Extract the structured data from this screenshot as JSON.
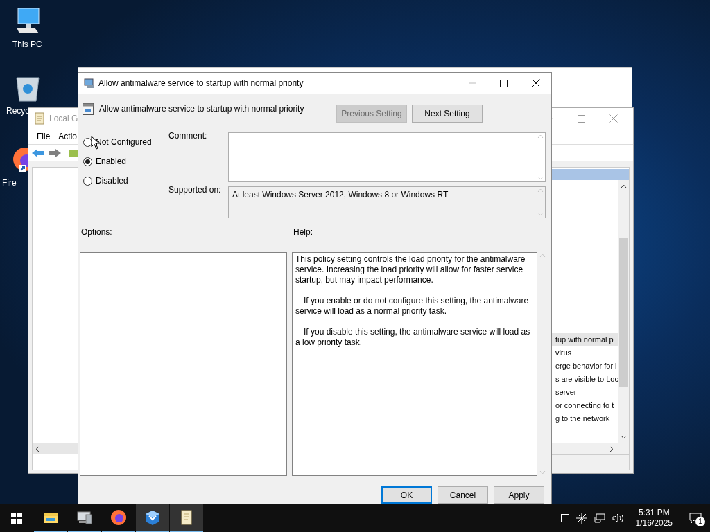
{
  "desktop_icons": [
    {
      "label": "This PC",
      "kind": "pc"
    },
    {
      "label": "Recyc",
      "kind": "recycle"
    },
    {
      "label": "Fire",
      "kind": "firefox"
    }
  ],
  "background_window": {
    "title": "Local G",
    "menu": [
      "File",
      "Actio"
    ],
    "list_rows": [
      {
        "text": "tup with normal p",
        "selected": true
      },
      {
        "text": "virus",
        "selected": false
      },
      {
        "text": "erge behavior for l",
        "selected": false
      },
      {
        "text": "s are visible to Loc",
        "selected": false
      },
      {
        "text": "server",
        "selected": false
      },
      {
        "text": "or connecting to t",
        "selected": false
      },
      {
        "text": "g to the network",
        "selected": false
      }
    ]
  },
  "dialog": {
    "title": "Allow antimalware service to startup with normal priority",
    "setting_title": "Allow antimalware service to startup with normal priority",
    "previous_button": {
      "label": "Previous Setting",
      "disabled": true
    },
    "next_button": {
      "label": "Next Setting",
      "disabled": false
    },
    "states": [
      {
        "label": "Not Configured",
        "selected": false
      },
      {
        "label": "Enabled",
        "selected": true
      },
      {
        "label": "Disabled",
        "selected": false
      }
    ],
    "comment_label": "Comment:",
    "supported_label": "Supported on:",
    "supported_text": "At least Windows Server 2012, Windows 8 or Windows RT",
    "options_label": "Options:",
    "help_label": "Help:",
    "help_paragraphs": [
      "This policy setting controls the load priority for the antimalware service. Increasing the load priority will allow for faster service startup, but may impact performance.",
      "If you enable or do not configure this setting, the antimalware service will load as a normal priority task.",
      "If you disable this setting, the antimalware service will load as a low priority task."
    ],
    "buttons": [
      {
        "label": "OK",
        "default": true
      },
      {
        "label": "Cancel",
        "default": false
      },
      {
        "label": "Apply",
        "default": false
      }
    ]
  },
  "taskbar": {
    "apps": [
      {
        "kind": "explorer",
        "active": false
      },
      {
        "kind": "server",
        "active": false
      },
      {
        "kind": "firefox",
        "active": false
      },
      {
        "kind": "box",
        "active": true
      },
      {
        "kind": "scroll",
        "active": true
      }
    ],
    "time": "5:31 PM",
    "date": "1/16/2025",
    "notification_count": "1"
  }
}
